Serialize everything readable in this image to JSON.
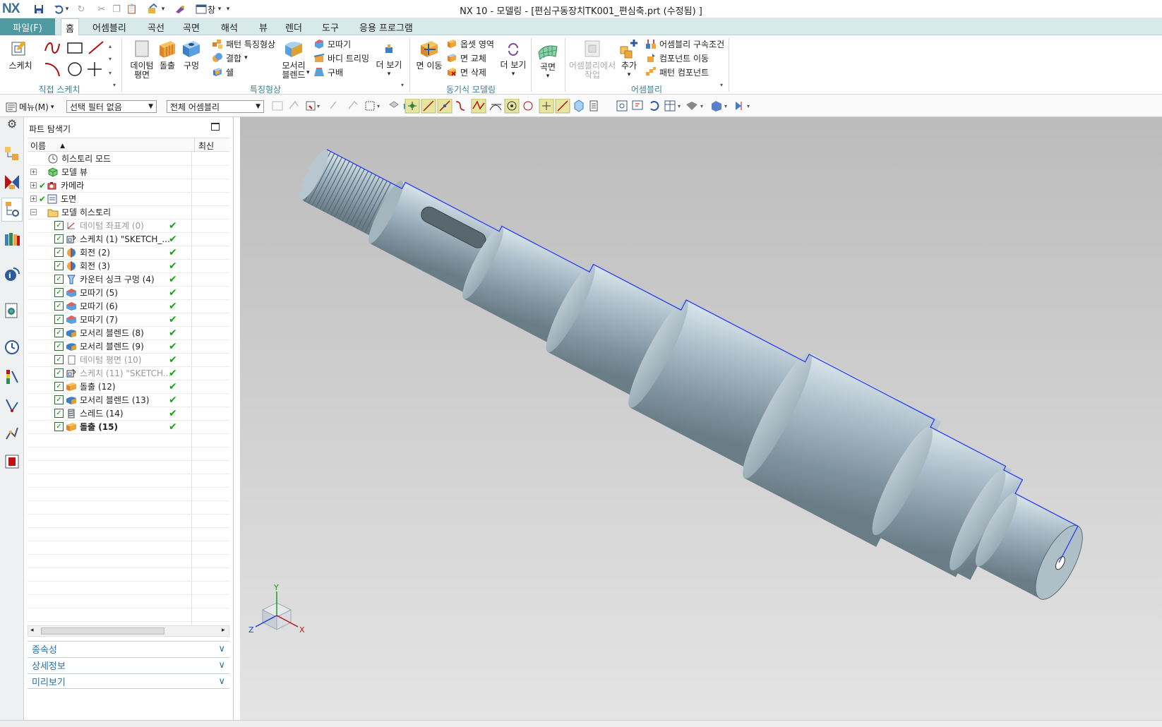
{
  "window": {
    "logo": "NX",
    "title": "NX 10 - 모델링 - [편심구동장치TK001_편심축.prt (수정됨) ]",
    "window_menu": "창"
  },
  "tabs": {
    "file": "파일(F)",
    "items": [
      "홈",
      "어셈블리",
      "곡선",
      "곡면",
      "해석",
      "뷰",
      "렌더",
      "도구",
      "응용 프로그램"
    ]
  },
  "ribbon": {
    "sketch": {
      "label": "스케치",
      "group": "직접 스케치"
    },
    "feature": {
      "datum": "데이텀\n평면",
      "extrude": "돌출",
      "hole": "구멍",
      "pattern": "패턴 특징형상",
      "unite": "결합",
      "shell": "쉘",
      "blend": "모서리\n블렌드",
      "chamfer": "모따기",
      "trim": "바디 트리밍",
      "draft": "구배",
      "more": "더 보기",
      "group": "특징형상"
    },
    "sync": {
      "move_face": "면 이동",
      "offset_region": "옵셋 영역",
      "replace_face": "면 교체",
      "delete_face": "면 삭제",
      "more": "더 보기",
      "group": "동기식 모델링"
    },
    "surface": {
      "label": "곡면"
    },
    "assembly": {
      "make_in_asm": "어셈블리에서\n작업",
      "add": "추가",
      "constraints": "어셈블리 구속조건",
      "move_component": "컴포넌트 이동",
      "pattern_component": "패턴 컴포넌트",
      "group": "어셈블리"
    }
  },
  "cmdbar": {
    "menu": "메뉴(M)",
    "filter": "선택 필터 없음",
    "scope": "전체 어셈블리"
  },
  "navigator": {
    "title": "파트 탐색기",
    "col_name": "이름",
    "col_latest": "최신",
    "rows": [
      {
        "name": "히스토리 모드",
        "indent": 0,
        "icon": "clock",
        "state": "normal",
        "check": false,
        "latest": false
      },
      {
        "name": "모델 뷰",
        "indent": 0,
        "icon": "views",
        "state": "normal",
        "check": false,
        "latest": false,
        "expander": true
      },
      {
        "name": "카메라",
        "indent": 0,
        "icon": "camera",
        "state": "normal",
        "check": false,
        "latest": false,
        "expander": true,
        "tick": true
      },
      {
        "name": "도면",
        "indent": 0,
        "icon": "drawing",
        "state": "normal",
        "check": false,
        "latest": false,
        "expander": true,
        "tick": true
      },
      {
        "name": "모델 히스토리",
        "indent": 0,
        "icon": "folder",
        "state": "normal",
        "check": false,
        "latest": false,
        "expander": true,
        "open": true
      },
      {
        "name": "데이텀 좌표계 (0)",
        "indent": 1,
        "icon": "csys",
        "state": "dim",
        "check": true,
        "latest": true
      },
      {
        "name": "스케치 (1) \"SKETCH_...",
        "indent": 1,
        "icon": "sketch",
        "state": "normal",
        "check": true,
        "latest": true
      },
      {
        "name": "회전 (2)",
        "indent": 1,
        "icon": "revolve",
        "state": "normal",
        "check": true,
        "latest": true
      },
      {
        "name": "회전 (3)",
        "indent": 1,
        "icon": "revolve",
        "state": "normal",
        "check": true,
        "latest": true
      },
      {
        "name": "카운터 싱크 구멍 (4)",
        "indent": 1,
        "icon": "hole",
        "state": "normal",
        "check": true,
        "latest": true
      },
      {
        "name": "모따기 (5)",
        "indent": 1,
        "icon": "chamfer",
        "state": "normal",
        "check": true,
        "latest": true
      },
      {
        "name": "모따기 (6)",
        "indent": 1,
        "icon": "chamfer",
        "state": "normal",
        "check": true,
        "latest": true
      },
      {
        "name": "모따기 (7)",
        "indent": 1,
        "icon": "chamfer",
        "state": "normal",
        "check": true,
        "latest": true
      },
      {
        "name": "모서리 블렌드 (8)",
        "indent": 1,
        "icon": "blend",
        "state": "normal",
        "check": true,
        "latest": true
      },
      {
        "name": "모서리 블렌드 (9)",
        "indent": 1,
        "icon": "blend",
        "state": "normal",
        "check": true,
        "latest": true
      },
      {
        "name": "데이텀 평면 (10)",
        "indent": 1,
        "icon": "plane",
        "state": "dim",
        "check": true,
        "latest": true
      },
      {
        "name": "스케치 (11) \"SKETCH...",
        "indent": 1,
        "icon": "sketch",
        "state": "dim",
        "check": true,
        "latest": true
      },
      {
        "name": "돌출 (12)",
        "indent": 1,
        "icon": "extrude",
        "state": "normal",
        "check": true,
        "latest": true
      },
      {
        "name": "모서리 블렌드 (13)",
        "indent": 1,
        "icon": "blend",
        "state": "normal",
        "check": true,
        "latest": true
      },
      {
        "name": "스레드 (14)",
        "indent": 1,
        "icon": "thread",
        "state": "normal",
        "check": true,
        "latest": true
      },
      {
        "name": "돌출 (15)",
        "indent": 1,
        "icon": "extrude",
        "state": "bold",
        "check": true,
        "latest": true
      }
    ],
    "panels": [
      "종속성",
      "상세정보",
      "미리보기"
    ]
  },
  "viewport": {
    "triad": {
      "x": "X",
      "y": "Y",
      "z": "Z"
    }
  },
  "colors": {
    "accent": "#4d9aa1",
    "tab_bar": "#d8e9ec",
    "group_label": "#3a7f96",
    "check_green": "#14a514",
    "edge_blue": "#2b3df0"
  }
}
